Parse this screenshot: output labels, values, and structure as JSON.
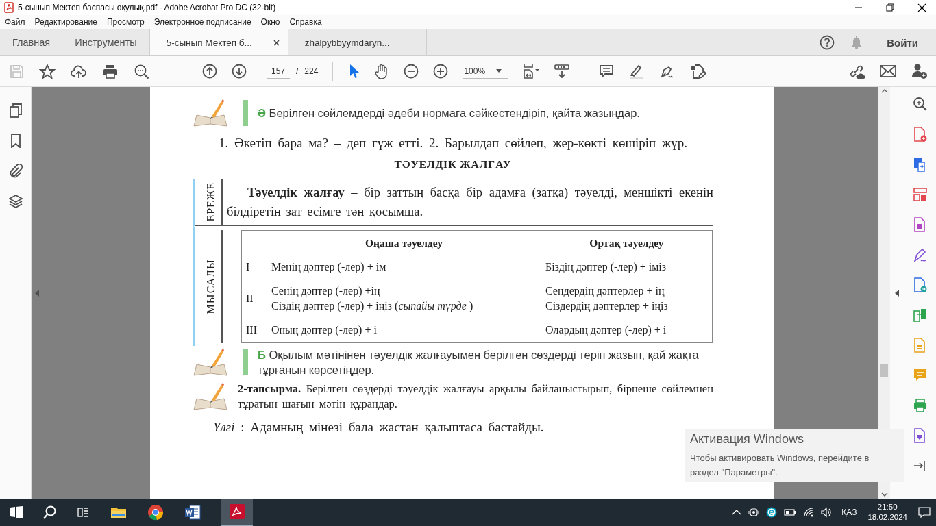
{
  "window": {
    "title": "5-сынып Мектеп баспасы оқулық.pdf - Adobe Acrobat Pro DC (32-bit)"
  },
  "menu": [
    "Файл",
    "Редактирование",
    "Просмотр",
    "Электронное подписание",
    "Окно",
    "Справка"
  ],
  "tabs": [
    {
      "label": "Главная",
      "kind": "nav",
      "selected": false,
      "closable": false
    },
    {
      "label": "Инструменты",
      "kind": "nav",
      "selected": false,
      "closable": false
    },
    {
      "label": "5-сынып Мектеп б...",
      "kind": "document",
      "selected": true,
      "closable": true
    },
    {
      "label": "zhalpybbyymdaryn...",
      "kind": "document",
      "selected": false,
      "closable": false
    }
  ],
  "sign_in": "Войти",
  "toolbar": {
    "page_current": "157",
    "page_separator": "/",
    "page_total": "224",
    "zoom": "100%"
  },
  "document": {
    "blocks": [
      {
        "kind": "task",
        "letter": "Ә",
        "text": "Берілген сөйлемдерді әдеби нормаға сәйкестендіріп, қайта жазыңдар."
      },
      {
        "kind": "paragraph",
        "text": "1. Әкетіп бара ма? – деп гүж етті. 2. Барылдап сөйлеп, жер-көкті көшіріп жүр."
      },
      {
        "kind": "heading",
        "text": "ТӘУЕЛДІК ЖАЛҒАУ"
      },
      {
        "kind": "rule",
        "label": "ЕРЕЖЕ",
        "text": "**Тәуелдік жалғау** – бір заттың басқа бір адамға (затқа) тәуелді, меншікті екенін білдіретін зат есімге тән қосымша."
      },
      {
        "kind": "table",
        "label": "МЫСАЛЫ",
        "columns": [
          "Оңаша тәуелдеу",
          "Ортақ тәуелдеу"
        ],
        "rows": [
          {
            "person": "I",
            "singular": [
              "Менің дәптер (-лер) + ім"
            ],
            "plural": [
              "Біздің дәптер (-лер) + іміз"
            ]
          },
          {
            "person": "II",
            "singular": [
              "Сенің дәптер (-лер) +ің",
              "Сіздің дәптер (-лер) + іңіз (*сыпайы түрде* )"
            ],
            "plural": [
              "Сендердің дәптерлер + ің",
              "Сіздердің дәптерлер + іңіз"
            ]
          },
          {
            "person": "III",
            "singular": [
              "Оның дәптер (-лер) + і"
            ],
            "plural": [
              "Олардың дәптер (-лер) + і"
            ]
          }
        ]
      },
      {
        "kind": "task",
        "letter": "Б",
        "text": "Оқылым мәтінінен тәуелдік жалғауымен берілген сөздерді теріп жазып, қай жақта тұрғанын көрсетіңдер."
      },
      {
        "kind": "assignment",
        "text": "**2-тапсырма.** Берілген сөздерді тәуелдік жалғауы арқылы байланыстырып, бірнеше сөйлемнен тұратын шағын мәтін құрандар."
      },
      {
        "kind": "example",
        "text": "*Үлгі* : Адамның мінезі бала жастан қалыптаса бастайды."
      }
    ]
  },
  "activation": {
    "title": "Активация Windows",
    "text": "Чтобы активировать Windows, перейдите в раздел \"Параметры\"."
  },
  "taskbar": {
    "language": "ҚАЗ",
    "time": "21:50",
    "date": "18.02.2024"
  }
}
